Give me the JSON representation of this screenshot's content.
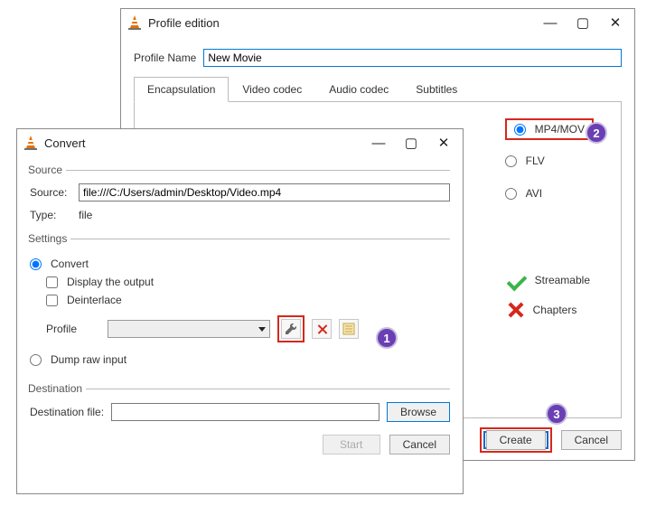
{
  "profile_window": {
    "title": "Profile edition",
    "name_label": "Profile Name",
    "name_value": "New Movie",
    "tabs": [
      "Encapsulation",
      "Video codec",
      "Audio codec",
      "Subtitles"
    ],
    "formats": {
      "mp4": "MP4/MOV",
      "flv": "FLV",
      "avi": "AVI"
    },
    "features": {
      "streamable": "Streamable",
      "chapters": "Chapters"
    },
    "create": "Create",
    "cancel": "Cancel"
  },
  "convert_window": {
    "title": "Convert",
    "source_group": "Source",
    "source_label": "Source:",
    "source_value": "file:///C:/Users/admin/Desktop/Video.mp4",
    "type_label": "Type:",
    "type_value": "file",
    "settings_group": "Settings",
    "convert_radio": "Convert",
    "display_output": "Display the output",
    "deinterlace": "Deinterlace",
    "profile_label": "Profile",
    "dump_radio": "Dump raw input",
    "destination_group": "Destination",
    "destination_label": "Destination file:",
    "browse": "Browse",
    "start": "Start",
    "cancel": "Cancel"
  },
  "markers": {
    "one": "1",
    "two": "2",
    "three": "3"
  }
}
